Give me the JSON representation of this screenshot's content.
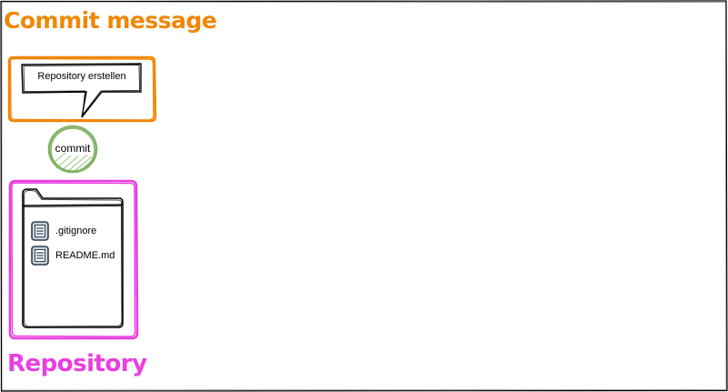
{
  "commit_section": {
    "title": "Commit message",
    "color": "#f08705",
    "message": "Repository erstellen"
  },
  "commit_node": {
    "label": "commit",
    "color": "#82b366"
  },
  "repository": {
    "title": "Repository",
    "color": "#ea3ee0",
    "files": [
      {
        "name": ".gitignore",
        "icon": "file-icon"
      },
      {
        "name": "README.md",
        "icon": "file-icon"
      }
    ]
  }
}
